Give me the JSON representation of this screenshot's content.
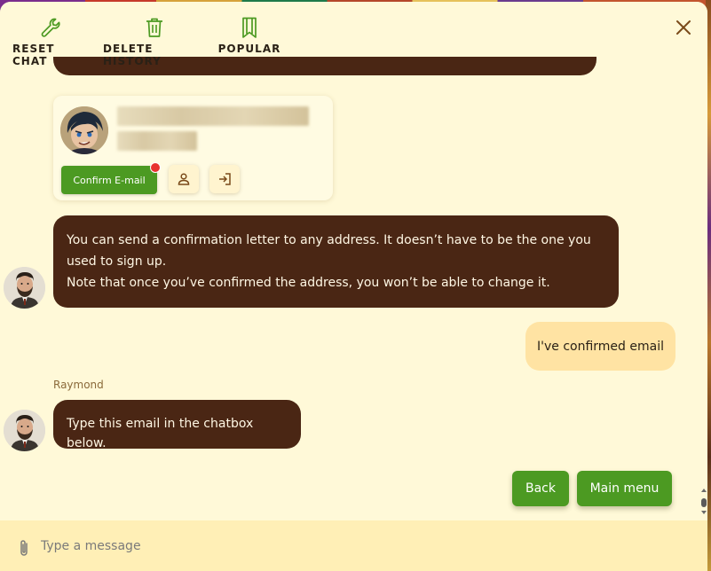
{
  "toolbar": {
    "reset_label": "RESET CHAT",
    "delete_label": "DELETE HISTORY",
    "popular_label": "POPULAR",
    "accent_color": "#4c9a22"
  },
  "card": {
    "confirm_label": "Confirm E-mail"
  },
  "messages": {
    "bot_1_line_1": "You can send a confirmation letter to any address. It doesn’t have to be the one you used to sign up.",
    "bot_1_line_2": "Note that once you’ve confirmed the address, you won’t be able to change it.",
    "user_1": "I've confirmed email",
    "sender_name": "Raymond",
    "bot_2": "Type this email in the chatbox below."
  },
  "actions": {
    "back_label": "Back",
    "main_menu_label": "Main menu"
  },
  "composer": {
    "placeholder": "Type a message"
  },
  "colors": {
    "panel_bg": "#fff9d8",
    "bot_bubble": "#4a2614",
    "user_bubble": "#ffe3a3",
    "button_green": "#4c9a22",
    "notification_red": "#e8322e"
  }
}
